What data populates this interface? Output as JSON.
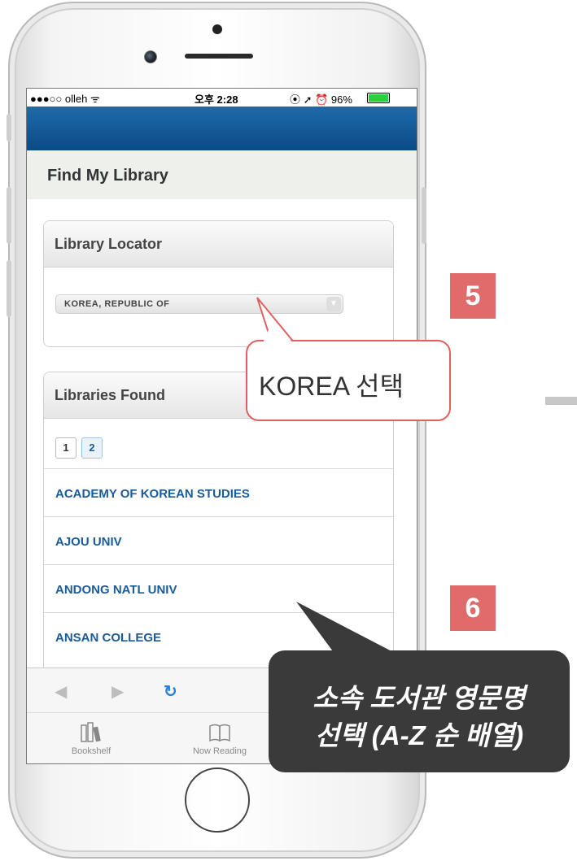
{
  "status_bar": {
    "carrier": "●●●○○ olleh ᯤ",
    "time": "오후 2:28",
    "indicators": "⦿ ➚ ⏰ 96%",
    "battery_percent": 96
  },
  "page_title": "Find My Library",
  "library_locator": {
    "heading": "Library Locator",
    "country_selected": "KOREA, REPUBLIC OF",
    "dropdown_arrow": "▼"
  },
  "libraries_found": {
    "heading": "Libraries Found",
    "pages": [
      "1",
      "2"
    ],
    "active_page": "2",
    "items": [
      {
        "label": "ACADEMY OF KOREAN STUDIES"
      },
      {
        "label": "AJOU UNIV"
      },
      {
        "label": "ANDONG NATL UNIV"
      },
      {
        "label": "ANSAN COLLEGE"
      }
    ]
  },
  "browser_nav": {
    "back": "◀",
    "forward": "▶",
    "reload": "↻"
  },
  "tabs": [
    {
      "label": "Bookshelf",
      "icon": "bookshelf-icon"
    },
    {
      "label": "Now Reading",
      "icon": "open-book-icon"
    }
  ],
  "annotations": {
    "step5": "5",
    "step6": "6",
    "callout_korea": "KOREA 선택",
    "callout_select_line1": "소속 도서관 영문명",
    "callout_select_line2": "선택 (A-Z 순 배열)"
  },
  "colors": {
    "header_blue": "#0a4b86",
    "link_blue": "#1a5b99",
    "badge_red": "#e06b6b",
    "callout_dark": "#3a3a3a"
  }
}
